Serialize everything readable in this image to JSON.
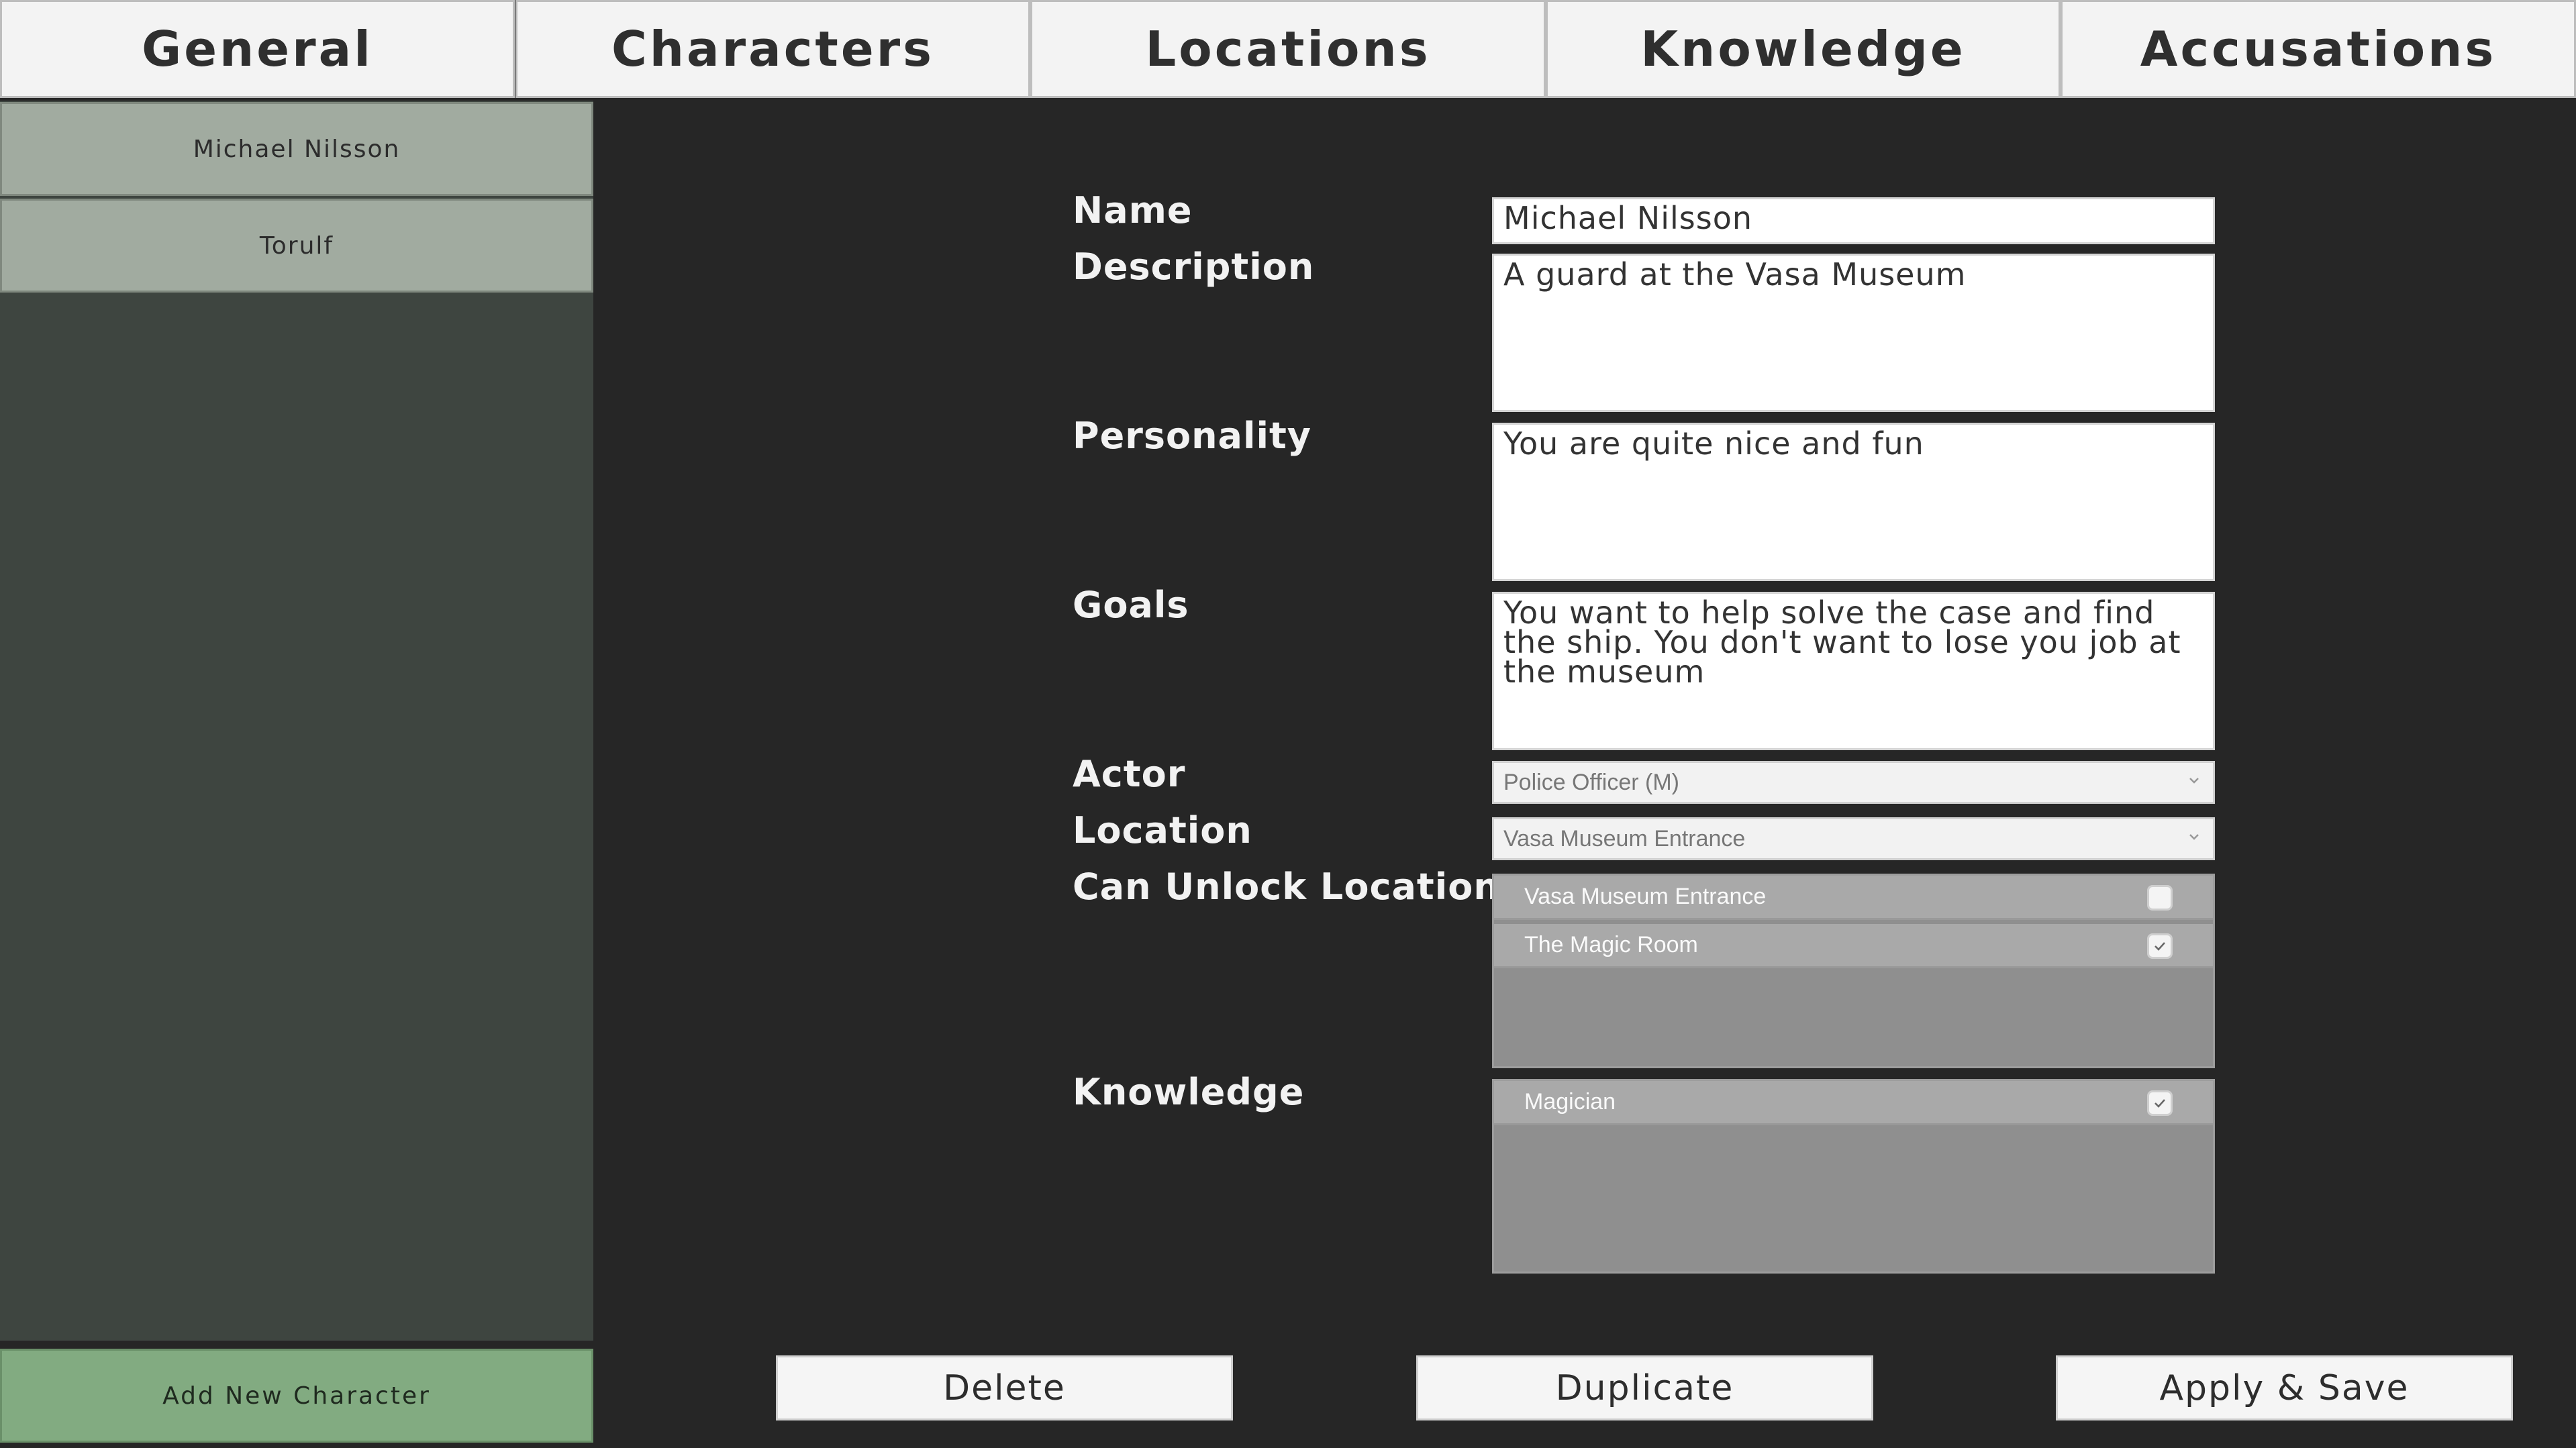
{
  "tabs": [
    {
      "label": "General"
    },
    {
      "label": "Characters"
    },
    {
      "label": "Locations"
    },
    {
      "label": "Knowledge"
    },
    {
      "label": "Accusations"
    }
  ],
  "sidebar": {
    "items": [
      {
        "label": "Michael Nilsson"
      },
      {
        "label": "Torulf"
      }
    ],
    "add_label": "Add New Character"
  },
  "form": {
    "name": {
      "label": "Name",
      "value": "Michael Nilsson"
    },
    "description": {
      "label": "Description",
      "value": "A guard at the Vasa Museum"
    },
    "personality": {
      "label": "Personality",
      "value": "You are quite nice and fun"
    },
    "goals": {
      "label": "Goals",
      "value": "You want to help solve the case and find the ship. You don't want to lose you job at the museum"
    },
    "actor": {
      "label": "Actor",
      "value": "Police Officer (M)"
    },
    "location": {
      "label": "Location",
      "value": "Vasa Museum Entrance"
    },
    "unlock_locations": {
      "label": "Can Unlock Locations:",
      "items": [
        {
          "label": "Vasa Museum Entrance",
          "checked": false
        },
        {
          "label": "The Magic Room",
          "checked": true
        }
      ]
    },
    "knowledge": {
      "label": "Knowledge",
      "items": [
        {
          "label": "Magician",
          "checked": true
        }
      ]
    }
  },
  "buttons": {
    "delete": "Delete",
    "duplicate": "Duplicate",
    "apply": "Apply & Save"
  },
  "colors": {
    "background": "#262626",
    "sidebar": "#3e4540",
    "sidebar_item": "#a1aba0",
    "add_button": "#82ab81"
  }
}
